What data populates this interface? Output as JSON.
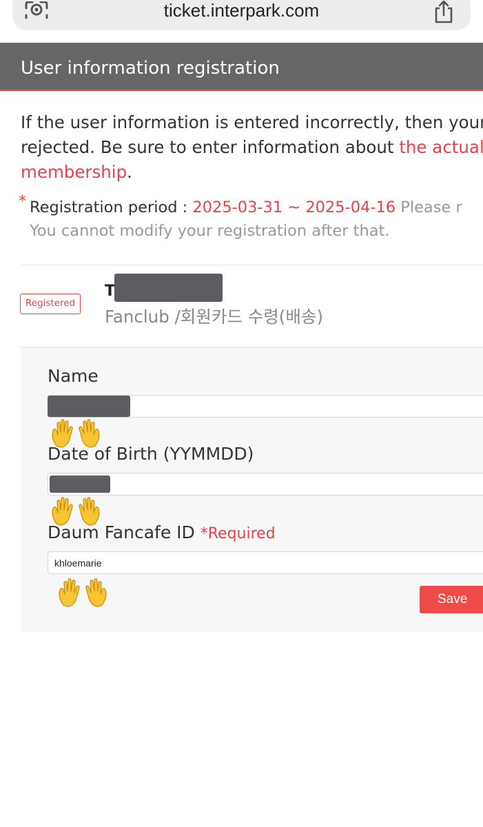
{
  "browser": {
    "url": "ticket.interpark.com"
  },
  "header": {
    "title": "User information registration"
  },
  "notice": {
    "line1": "If the user information is entered incorrectly, then your",
    "line2_prefix": "rejected. Be sure to enter information about ",
    "line2_highlight": "the actual",
    "line3_highlight": "membership",
    "line3_suffix": "."
  },
  "period": {
    "bullet": "*",
    "label": "Registration period : ",
    "dates": "2025-03-31 ~ 2025-04-16",
    "after": " Please r",
    "line2": "You cannot modify your registration after that."
  },
  "membership": {
    "status_badge": "Registered",
    "name_initial": "T",
    "type": "Fanclub /회원카드 수령(배송)"
  },
  "form": {
    "name_label": "Name",
    "name_value": "",
    "dob_label": "Date of Birth (YYMMDD)",
    "dob_value": "",
    "fancafe_label": "Daum Fancafe ID ",
    "fancafe_required": "*Required",
    "fancafe_value": "khloemarie",
    "save_label": "Save"
  },
  "colors": {
    "accent": "#e8414a",
    "header_bg": "#666666",
    "panel_bg": "#f7f7f7"
  },
  "icons": [
    "lens-icon",
    "share-icon",
    "raising-hands-icon"
  ]
}
